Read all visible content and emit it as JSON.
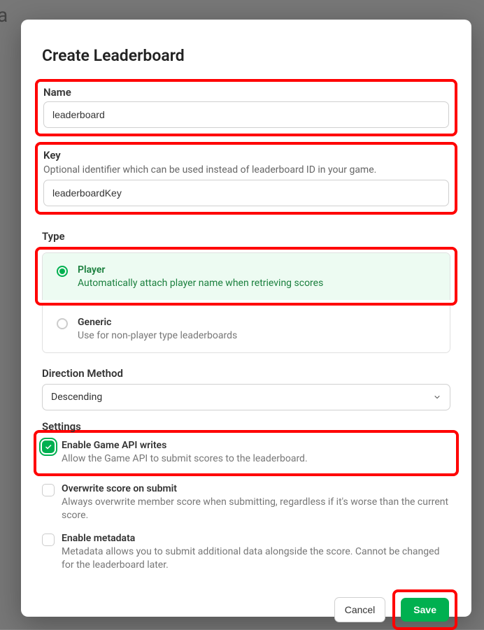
{
  "backdrop": {
    "partial_text": "oa"
  },
  "modal": {
    "title": "Create Leaderboard",
    "name": {
      "label": "Name",
      "value": "leaderboard"
    },
    "key": {
      "label": "Key",
      "hint": "Optional identifier which can be used instead of leaderboard ID in your game.",
      "value": "leaderboardKey"
    },
    "type": {
      "label": "Type",
      "options": [
        {
          "title": "Player",
          "desc": "Automatically attach player name when retrieving scores",
          "selected": true
        },
        {
          "title": "Generic",
          "desc": "Use for non-player type leaderboards",
          "selected": false
        }
      ]
    },
    "direction": {
      "label": "Direction Method",
      "value": "Descending"
    },
    "settings": {
      "label": "Settings",
      "items": [
        {
          "title": "Enable Game API writes",
          "desc": "Allow the Game API to submit scores to the leaderboard.",
          "checked": true
        },
        {
          "title": "Overwrite score on submit",
          "desc": "Always overwrite member score when submitting, regardless if it's worse than the current score.",
          "checked": false
        },
        {
          "title": "Enable metadata",
          "desc": "Metadata allows you to submit additional data alongside the score. Cannot be changed for the leaderboard later.",
          "checked": false
        }
      ]
    },
    "footer": {
      "cancel": "Cancel",
      "save": "Save"
    }
  }
}
